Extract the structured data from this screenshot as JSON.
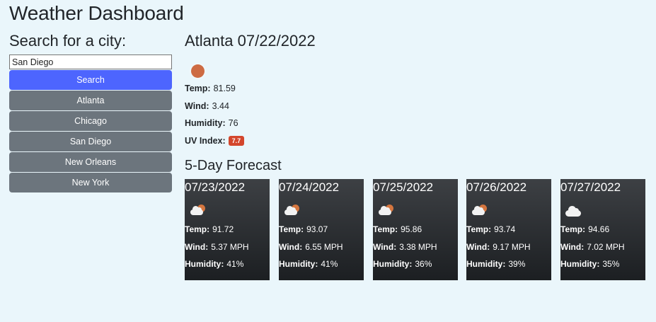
{
  "app": {
    "title": "Weather Dashboard"
  },
  "sidebar": {
    "heading": "Search for a city:",
    "search_value": "San Diego",
    "search_label": "Search",
    "history": [
      "Atlanta",
      "Chicago",
      "San Diego",
      "New Orleans",
      "New York"
    ]
  },
  "current": {
    "title": "Atlanta 07/22/2022",
    "icon": "sun-icon",
    "temp_label": "Temp:",
    "temp": "81.59",
    "wind_label": "Wind:",
    "wind": "3.44",
    "humidity_label": "Humidity:",
    "humidity": "76",
    "uv_label": "UV Index:",
    "uv": "7.7"
  },
  "forecast": {
    "heading": "5-Day Forecast",
    "days": [
      {
        "date": "07/23/2022",
        "icon": "partly-cloudy-icon",
        "temp": "91.72",
        "wind": "5.37 MPH",
        "humidity": "41%"
      },
      {
        "date": "07/24/2022",
        "icon": "partly-cloudy-icon",
        "temp": "93.07",
        "wind": "6.55 MPH",
        "humidity": "41%"
      },
      {
        "date": "07/25/2022",
        "icon": "partly-cloudy-icon",
        "temp": "95.86",
        "wind": "3.38 MPH",
        "humidity": "36%"
      },
      {
        "date": "07/26/2022",
        "icon": "partly-cloudy-icon",
        "temp": "93.74",
        "wind": "9.17 MPH",
        "humidity": "39%"
      },
      {
        "date": "07/27/2022",
        "icon": "cloudy-icon",
        "temp": "94.66",
        "wind": "7.02 MPH",
        "humidity": "35%"
      }
    ],
    "temp_label": "Temp:",
    "wind_label": "Wind:",
    "humidity_label": "Humidity:"
  },
  "colors": {
    "background": "#eaf6fb",
    "search_button": "#4d65fe",
    "history_button": "#6c757d",
    "uv_badge": "#d3462c"
  }
}
